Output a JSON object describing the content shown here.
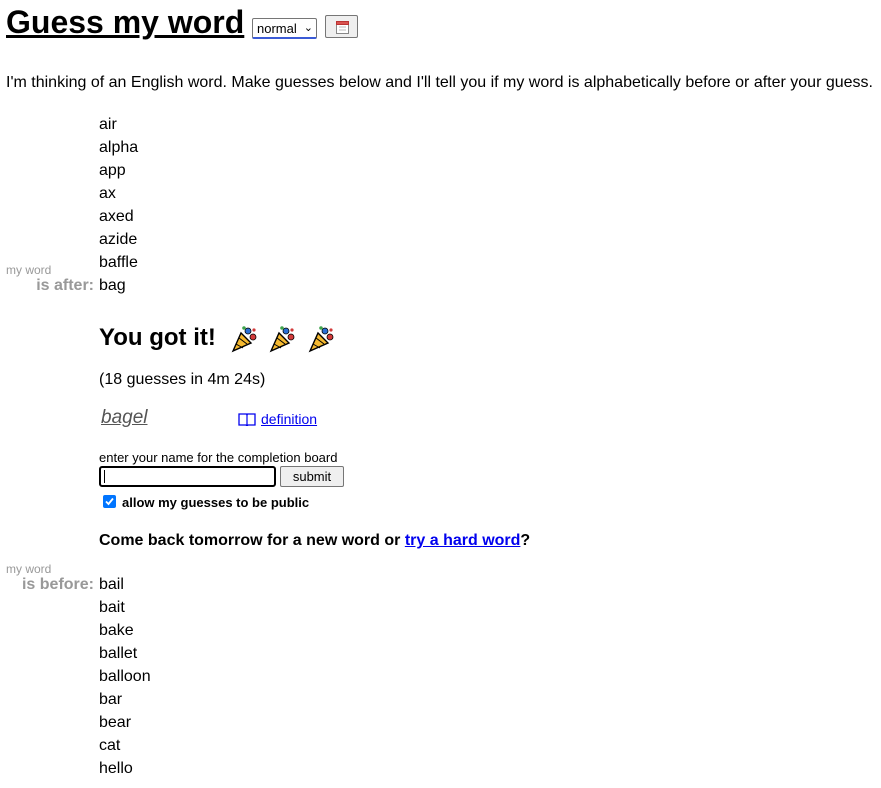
{
  "header": {
    "title": "Guess my word",
    "difficulty_selected": "normal",
    "calendar_icon": "calendar-icon"
  },
  "intro": "I'm thinking of an English word. Make guesses below and I'll tell you if my word is alphabetically before or after your guess.",
  "after_section": {
    "label_small": "my word",
    "label_big": "is after:",
    "words": [
      "air",
      "alpha",
      "app",
      "ax",
      "axed",
      "azide",
      "baffle",
      "bag"
    ]
  },
  "result": {
    "headline": "You got it!",
    "celebration_icon": "party-popper-icon",
    "guess_summary": "(18 guesses in 4m 24s)",
    "answer": "bagel",
    "definition_link": "definition",
    "name_label": "enter your name for the completion board",
    "name_value": "",
    "submit_label": "submit",
    "public_checkbox_label": "allow my guesses to be public",
    "public_checked": true,
    "come_back_prefix": "Come back tomorrow for a new word or ",
    "hard_word_link": "try a hard word",
    "come_back_suffix": "?"
  },
  "before_section": {
    "label_small": "my word",
    "label_big": "is before:",
    "words": [
      "bail",
      "bait",
      "bake",
      "ballet",
      "balloon",
      "bar",
      "bear",
      "cat",
      "hello"
    ]
  },
  "colors": {
    "link": "#0000ee",
    "muted_label": "#999999",
    "checkbox": "#0075ff",
    "select_focus": "#3b5bd6"
  }
}
